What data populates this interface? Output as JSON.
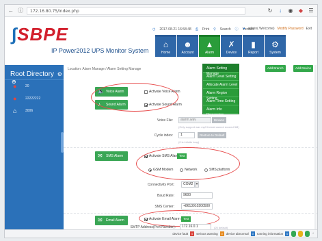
{
  "browser": {
    "url": "172.16.80.75/index.php",
    "icons": [
      "back-icon",
      "forward-icon",
      "reload-icon",
      "download-icon",
      "lock-icon",
      "shield-icon",
      "menu-icon"
    ]
  },
  "header": {
    "logo_text": "SBPE",
    "subtitle": "IP Power2012 UPS Monitor System",
    "datetime": "2017-08-21 16:58:48",
    "print_label": "Print",
    "search_label": "Search",
    "version_label": "Version",
    "user_label": "admin( Welcome)",
    "modify_password": "Modify Password",
    "exit": "Exit"
  },
  "menu": [
    {
      "label": "Home",
      "icon": "home-icon",
      "active": false
    },
    {
      "label": "Account",
      "icon": "user-icon",
      "active": false
    },
    {
      "label": "Alarm",
      "icon": "alarm-icon",
      "active": true
    },
    {
      "label": "Device",
      "icon": "tools-icon",
      "active": false
    },
    {
      "label": "Report",
      "icon": "report-icon",
      "active": false
    },
    {
      "label": "System",
      "icon": "gear-icon",
      "active": false
    }
  ],
  "alarm_dropdown": [
    "Alarm Setting Manage",
    "Alarm Level Setting",
    "Allocate Alarm Level",
    "Alarm Region Setting",
    "Alarm Time Setting",
    "Alarm Info Processing"
  ],
  "sidebar": {
    "title": "Root Directory",
    "items": [
      {
        "label": "20"
      },
      {
        "label": "22222222"
      },
      {
        "label": "3006"
      }
    ]
  },
  "content": {
    "breadcrumb": "Location: Alarm Manage / Alarm Setting Manage",
    "buttons": {
      "add_branch": "Add Branch",
      "add_device": "Add Device"
    },
    "voice_alarm": {
      "label": "Voice Alarm",
      "activate": "Activate Voice Alarm",
      "checked": false
    },
    "sound_alarm": {
      "label": "Sound Alarm",
      "activate": "Activate Sound Alarm",
      "checked": true,
      "voice_file_label": "Voice File:",
      "voice_file_value": "alarm.wav",
      "browse": "Browse",
      "voice_file_hint": "(Only support wav mp3 format cannot exceed 5M)",
      "cycle_index_label": "Cycle index:",
      "cycle_index_value": "1",
      "restore_default": "Restore to Default",
      "cycle_hint": "(0 is infinite loop)"
    },
    "sms_alarm": {
      "label": "SMS Alarm",
      "activate": "Activate SMS Alarm",
      "checked": true,
      "test": "Test",
      "modes": [
        {
          "label": "GSM Modem",
          "checked": true
        },
        {
          "label": "Network",
          "checked": false
        },
        {
          "label": "SMS platform",
          "checked": false
        }
      ],
      "connectivity_label": "Connectivity Port:",
      "connectivity_value": "COM2",
      "baud_label": "Baud Rate:",
      "baud_value": "9600",
      "sms_center_label": "SMS Center:",
      "sms_center_value": "+8613010200500"
    },
    "email_alarm": {
      "label": "Email Alarm",
      "activate": "Activate Email Alarm",
      "checked": true,
      "test": "Test",
      "smtp_label": "SMTP Address(Port Number):",
      "smtp_value": "172.16.0.1",
      "smtp_hint": "(25 default)"
    }
  },
  "statusbar": {
    "device_fault": "device fault",
    "device_fault_count": "0",
    "serious_warning": "serious warning",
    "serious_warning_count": "0",
    "device_abnormal": "device abnormal",
    "device_abnormal_count": "0",
    "running_information": "running information",
    "running_information_count": "0"
  },
  "colors": {
    "brand_red": "#d21f2c",
    "menu_blue": "#2f67a8",
    "active_green": "#2a9c3a",
    "sidebar_blue": "#2b71b9",
    "annotation_red": "#e74c4c"
  }
}
